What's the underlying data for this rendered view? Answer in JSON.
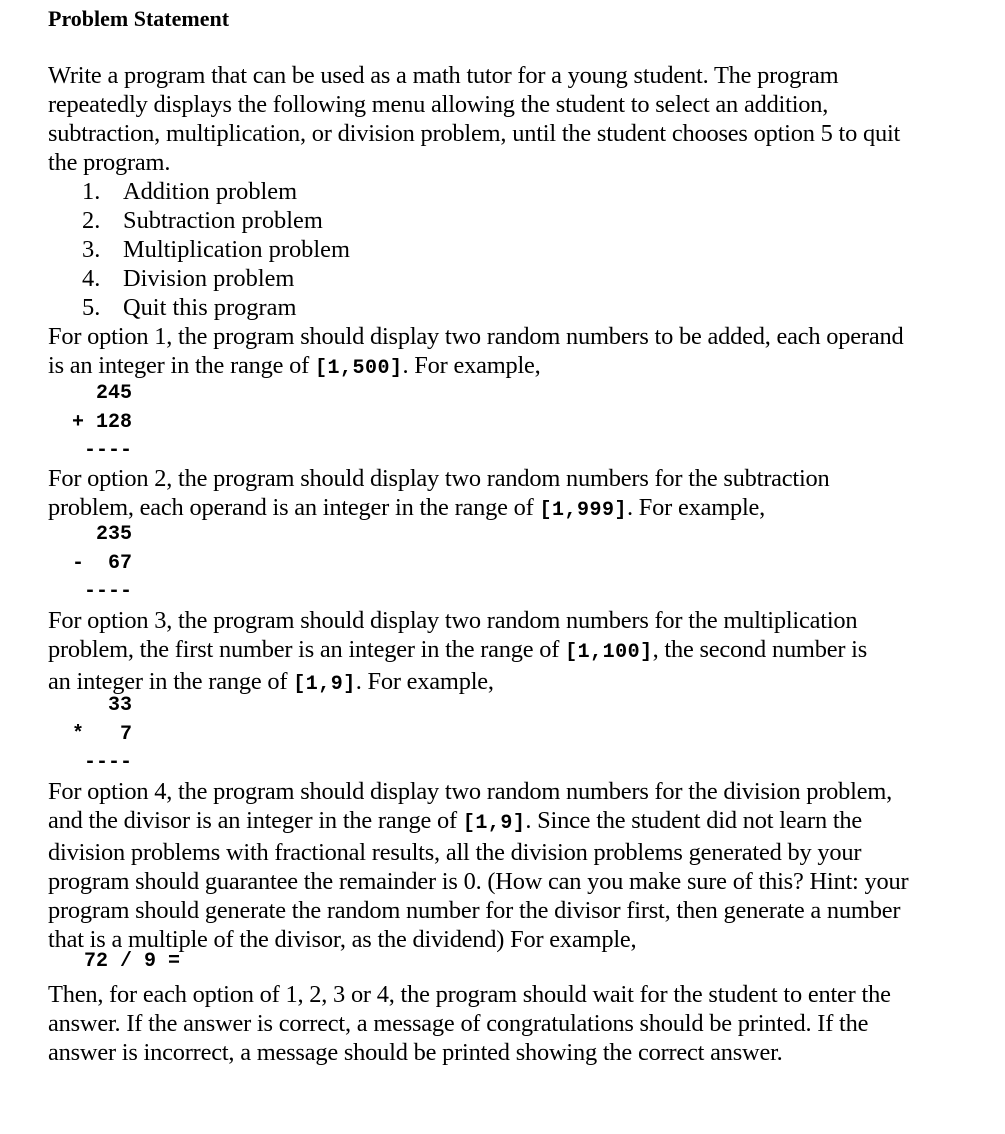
{
  "title": "Problem Statement",
  "intro": {
    "lines": [
      "Write a program that can be used as a math tutor for a young student. The program",
      "repeatedly displays the following menu allowing the student to select an addition,",
      "subtraction, multiplication, or division problem, until the student chooses option 5 to quit",
      "the program."
    ]
  },
  "menu": [
    {
      "number": "1.",
      "label": "Addition problem"
    },
    {
      "number": "2.",
      "label": "Subtraction problem"
    },
    {
      "number": "3.",
      "label": "Multiplication problem"
    },
    {
      "number": "4.",
      "label": "Division problem"
    },
    {
      "number": "5.",
      "label": "Quit this program"
    }
  ],
  "option1": {
    "line1": "For option 1, the program should display two random numbers to be added, each operand",
    "line2_pre": "is an integer in the range of ",
    "range": "[1,500]",
    "line2_post": ". For example,",
    "example": [
      "    245",
      "  + 128",
      "   ----"
    ]
  },
  "option2": {
    "line1": "For option 2, the program should display two random numbers for the subtraction",
    "line2_pre": "problem, each operand is an integer in the range of ",
    "range": "[1,999]",
    "line2_post": ". For example,",
    "example": [
      "    235",
      "  -  67",
      "   ----"
    ]
  },
  "option3": {
    "line1": "For option 3, the program should display two random numbers for the multiplication",
    "line2_pre": "problem, the first number is an integer in the range of ",
    "range1": "[1,100]",
    "line2_post": ", the second number is",
    "line3_pre": "an integer in the range of ",
    "range2": "[1,9]",
    "line3_post": ". For example,",
    "example": [
      "     33",
      "  *   7",
      "   ----"
    ]
  },
  "option4": {
    "line1": "For option 4, the program should display two random numbers for the division problem,",
    "line2_pre": "and the divisor is an integer in the range of ",
    "range": "[1,9]",
    "line2_post": ". Since the student did not learn the",
    "line3": "division problems with fractional results, all the division problems generated by your",
    "line4": "program should guarantee the remainder is 0. (How can you make sure of this? Hint: your",
    "line5": "program should generate the random number for the divisor first, then generate a number",
    "line6": "that is a multiple of the divisor, as the dividend) For example,",
    "example": "   72 / 9 ="
  },
  "closing": {
    "lines": [
      "Then, for each option of 1, 2, 3 or 4, the program should wait for the student to enter the",
      "answer. If the answer is correct, a message of congratulations should be printed. If the",
      "answer is incorrect, a message should be printed showing the correct answer."
    ]
  }
}
